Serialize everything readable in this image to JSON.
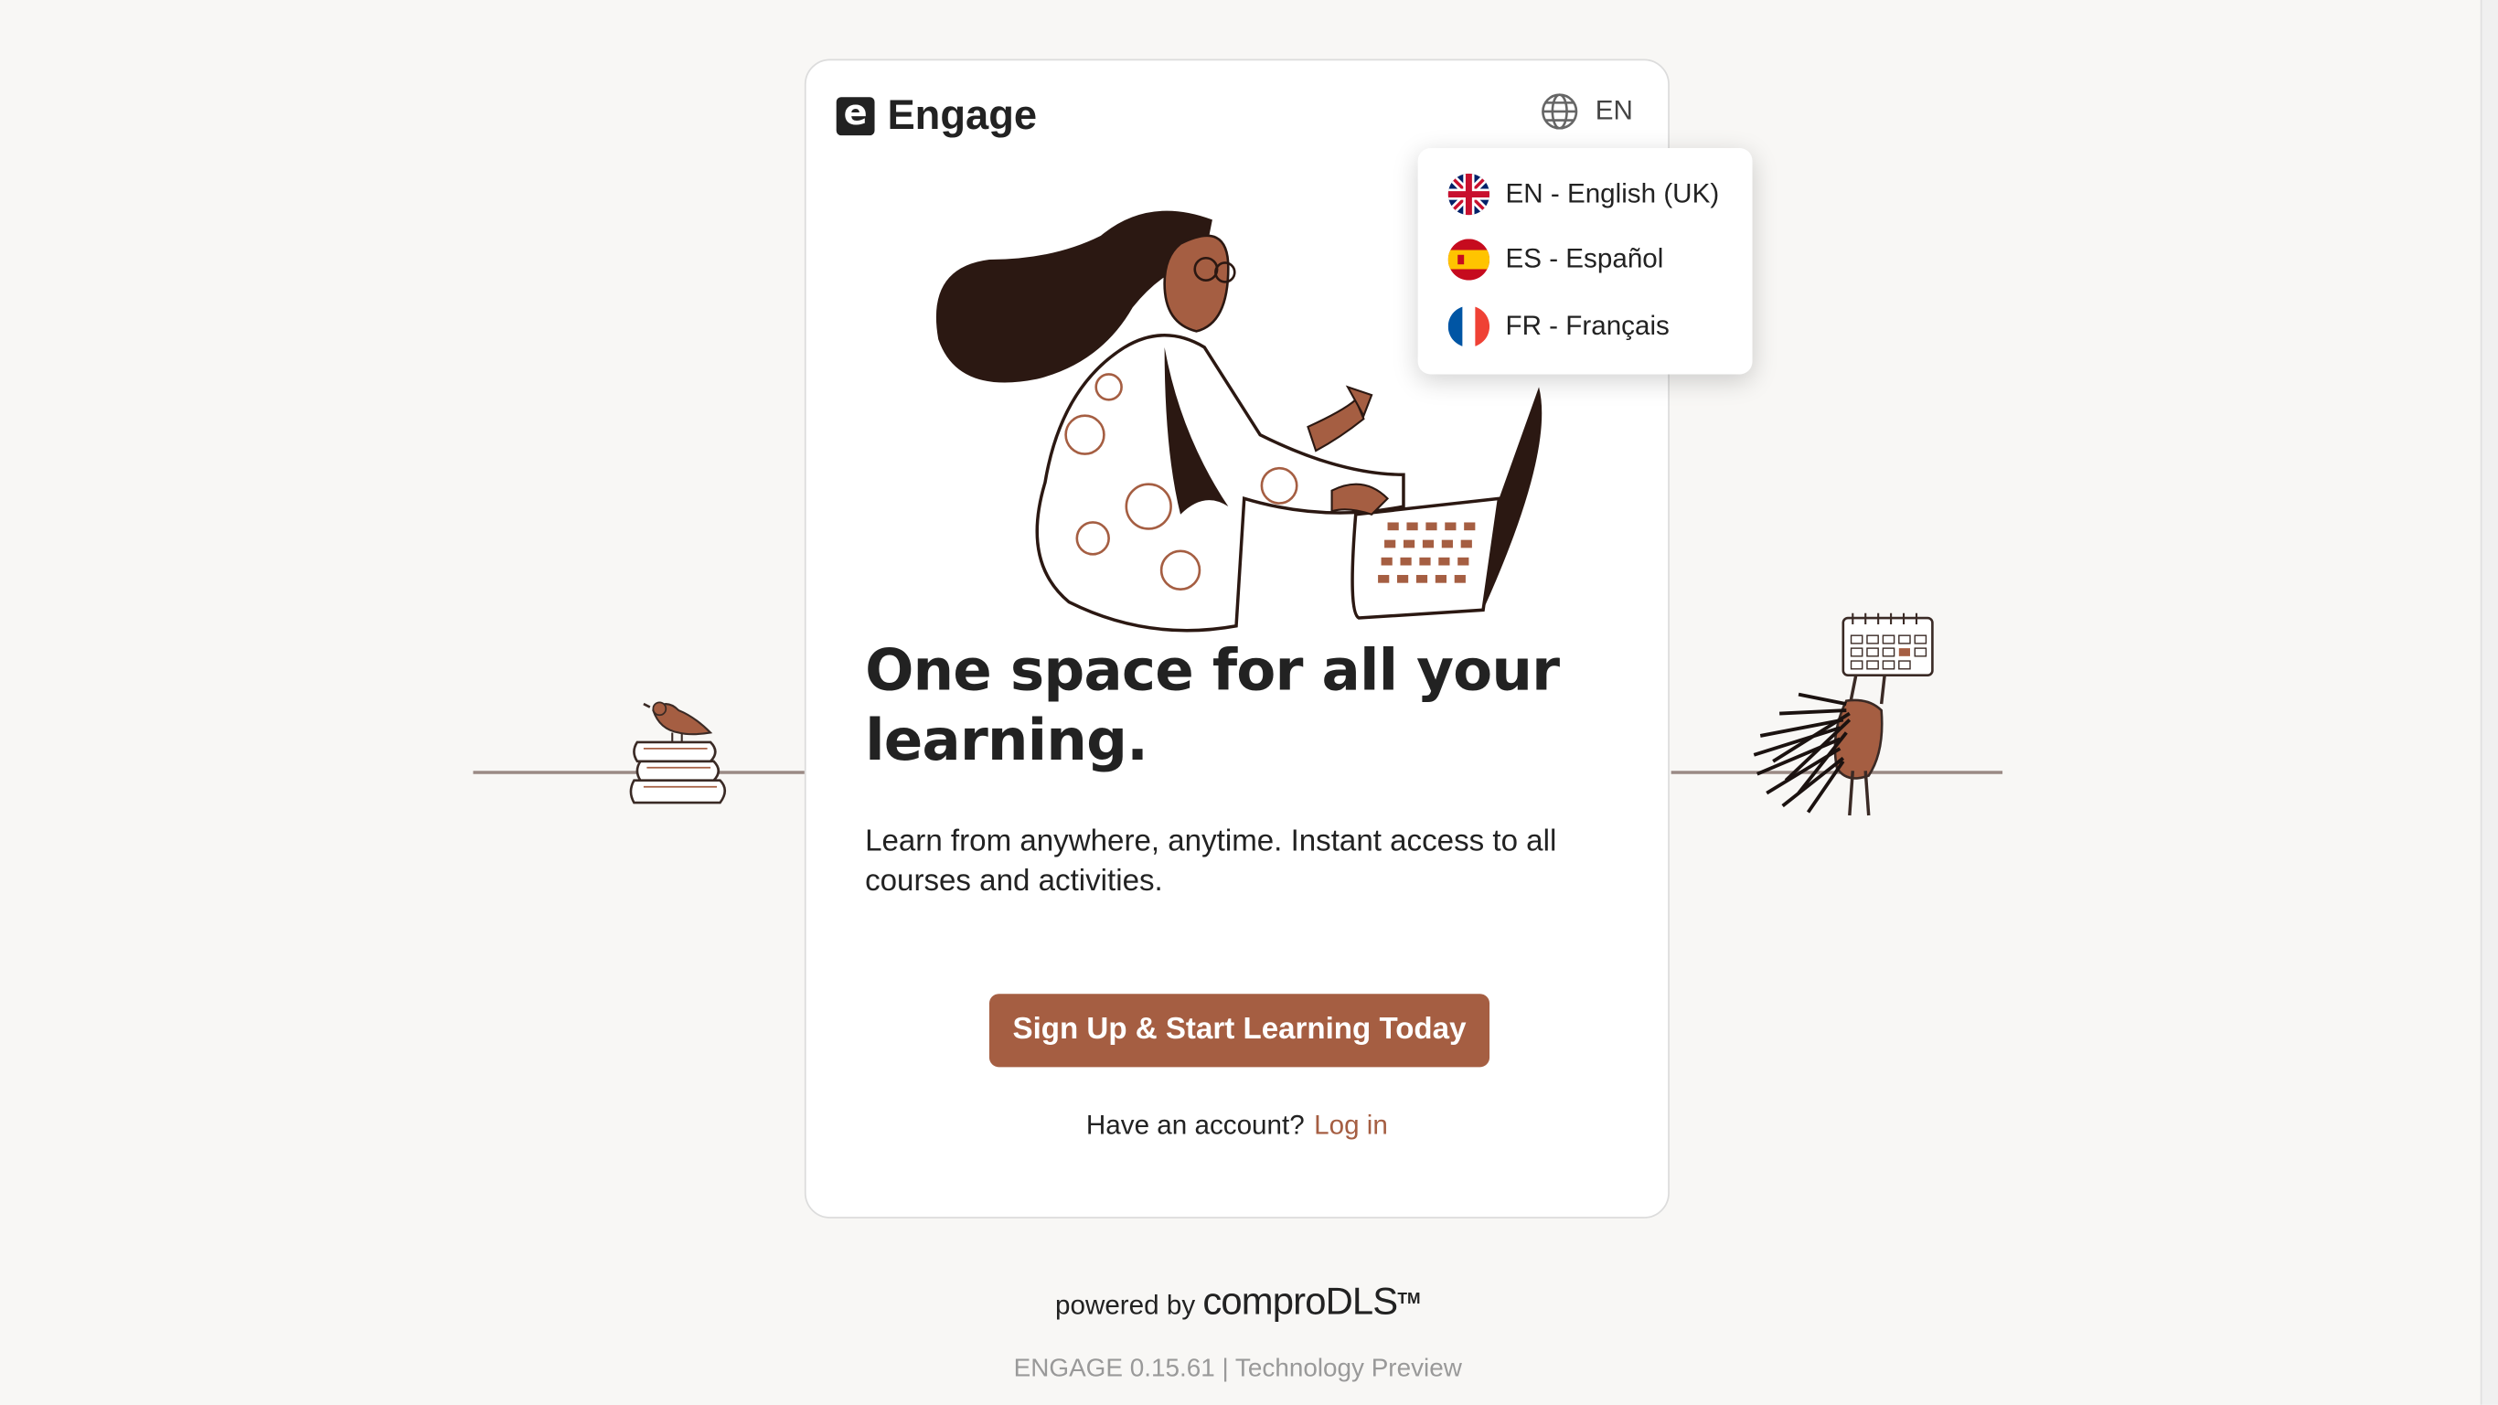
{
  "brand": {
    "logo_letter": "e",
    "name": "Engage"
  },
  "language": {
    "current": "EN",
    "options": [
      {
        "label": "EN - English (UK)",
        "flag": "uk-flag-icon"
      },
      {
        "label": "ES - Español",
        "flag": "spain-flag-icon"
      },
      {
        "label": "FR - Français",
        "flag": "france-flag-icon"
      }
    ]
  },
  "hero": {
    "headline": "One space for all your learning.",
    "subtext": "Learn from anywhere, anytime. Instant access to all courses and activities."
  },
  "cta": {
    "label": "Sign Up & Start Learning Today"
  },
  "account": {
    "prompt": "Have an account?",
    "login_label": "Log in"
  },
  "footer": {
    "powered_by": "powered by",
    "brand": "comproDLS",
    "trademark": "TM",
    "version": "ENGAGE 0.15.61 | Technology Preview"
  },
  "colors": {
    "accent": "#a55e42",
    "background": "#f8f7f5",
    "dark": "#2b1812"
  }
}
